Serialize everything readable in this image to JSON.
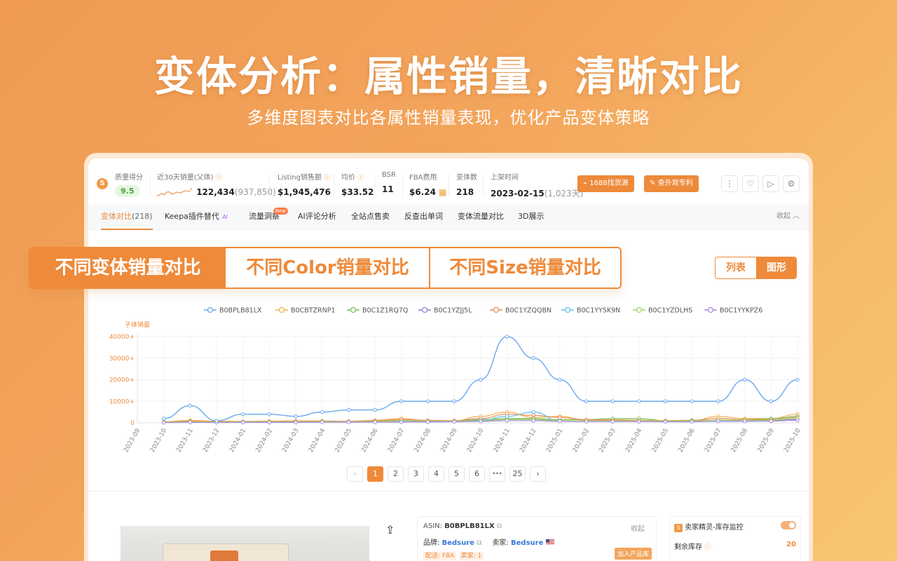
{
  "hero": {
    "title": "变体分析：属性销量，清晰对比",
    "subtitle": "多维度图表对比各属性销量表现，优化产品变体策略"
  },
  "metrics": {
    "logo": "S",
    "quality": {
      "label": "质量得分",
      "value": "9.5"
    },
    "sales30": {
      "label": "近30天销量(父体)",
      "value": "122,434",
      "sub": "(937,850)"
    },
    "listing": {
      "label": "Listing销售额",
      "value": "$1,945,476"
    },
    "avg_price": {
      "label": "均价",
      "value": "$33.52"
    },
    "bsr": {
      "label": "BSR",
      "value": "11"
    },
    "fba": {
      "label": "FBA费用",
      "value": "$6.24"
    },
    "variants": {
      "label": "变体数",
      "value": "218"
    },
    "launch": {
      "label": "上架时间",
      "value": "2023-02-15",
      "sub": "(1,023天)"
    },
    "btn_1688": "1688找货源",
    "btn_patent": "查外观专利"
  },
  "tabs": {
    "variant": "变体对比",
    "variant_count": "(218)",
    "keepa": "Keepa插件替代",
    "keepa_ai": "AI",
    "traffic": "流量洞察",
    "traffic_new": "New",
    "ai_review": "AI评论分析",
    "sitewide": "全站点售卖",
    "reverse": "反查出单词",
    "variant_traffic": "变体流量对比",
    "show3d": "3D展示",
    "collapse": "收起"
  },
  "segments": {
    "s1": "不同变体销量对比",
    "s2": "不同Color销量对比",
    "s3": "不同Size销量对比"
  },
  "view_toggle": {
    "list": "列表",
    "graph": "图形"
  },
  "chart_data": {
    "type": "line",
    "ylabel": "子体销量",
    "y_ticks": [
      "0",
      "10000+",
      "20000+",
      "30000+",
      "40000+"
    ],
    "ylim": [
      0,
      40000
    ],
    "x": [
      "2023-09",
      "2023-10",
      "2023-11",
      "2023-12",
      "2024-01",
      "2024-02",
      "2024-03",
      "2024-04",
      "2024-05",
      "2024-06",
      "2024-07",
      "2024-08",
      "2024-09",
      "2024-10",
      "2024-11",
      "2024-12",
      "2025-01",
      "2025-02",
      "2025-03",
      "2025-04",
      "2025-05",
      "2025-06",
      "2025-07",
      "2025-08",
      "2025-09",
      "2025-10"
    ],
    "legend_position": "top",
    "series": [
      {
        "name": "B0BPLB81LX",
        "color": "#6aa8ee",
        "values": [
          null,
          2000,
          8000,
          1000,
          4000,
          4000,
          3000,
          5000,
          6000,
          6000,
          10000,
          10000,
          10000,
          20000,
          40000,
          30000,
          20000,
          10000,
          10000,
          10000,
          10000,
          10000,
          10000,
          20000,
          10000,
          20000
        ]
      },
      {
        "name": "B0CBTZRNP1",
        "color": "#f3b04e",
        "values": [
          null,
          500,
          1200,
          800,
          700,
          800,
          900,
          900,
          700,
          1200,
          2000,
          1000,
          1000,
          3000,
          5000,
          2500,
          3000,
          1200,
          1500,
          1200,
          1000,
          1000,
          3000,
          2000,
          2000,
          4000
        ]
      },
      {
        "name": "B0C1Z1RQ7Q",
        "color": "#77c05a",
        "values": [
          null,
          300,
          600,
          400,
          500,
          500,
          500,
          800,
          600,
          800,
          1000,
          800,
          1000,
          1500,
          2000,
          2000,
          1500,
          1500,
          2000,
          2000,
          1000,
          1200,
          2000,
          1500,
          2000,
          3000
        ]
      },
      {
        "name": "B0C1YZJJ5L",
        "color": "#8c84e0",
        "values": [
          null,
          200,
          300,
          200,
          300,
          300,
          300,
          400,
          400,
          500,
          600,
          600,
          700,
          1000,
          1500,
          1500,
          1000,
          800,
          800,
          800,
          700,
          700,
          900,
          900,
          1000,
          1500
        ]
      },
      {
        "name": "B0C1YZQQBN",
        "color": "#ee8a5c",
        "values": [
          null,
          400,
          800,
          500,
          600,
          600,
          700,
          700,
          800,
          1000,
          1500,
          1200,
          1000,
          2000,
          4000,
          3500,
          2500,
          1500,
          1200,
          1200,
          1000,
          1000,
          2000,
          1500,
          1500,
          2500
        ]
      },
      {
        "name": "B0C1YYSK9N",
        "color": "#5fbfe8",
        "values": [
          null,
          200,
          400,
          300,
          400,
          400,
          400,
          500,
          500,
          600,
          800,
          700,
          800,
          1200,
          3000,
          5000,
          1000,
          800,
          800,
          800,
          700,
          700,
          900,
          900,
          1000,
          2000
        ]
      },
      {
        "name": "B0C1YZDLHS",
        "color": "#a3d65a",
        "values": [
          null,
          300,
          500,
          300,
          400,
          400,
          400,
          500,
          500,
          600,
          700,
          700,
          800,
          1000,
          1500,
          1500,
          1000,
          900,
          900,
          900,
          800,
          800,
          1200,
          1200,
          1200,
          2000
        ]
      },
      {
        "name": "B0C1YYKPZ6",
        "color": "#a98ae6",
        "values": [
          null,
          100,
          200,
          150,
          200,
          200,
          200,
          300,
          300,
          300,
          400,
          400,
          500,
          700,
          1000,
          1000,
          700,
          600,
          600,
          600,
          500,
          500,
          700,
          700,
          800,
          1200
        ]
      }
    ]
  },
  "pager": {
    "prev": "‹",
    "p1": "1",
    "p2": "2",
    "p3": "3",
    "p4": "4",
    "p5": "5",
    "p6": "6",
    "ellipsis": "•••",
    "last": "25",
    "next": "›"
  },
  "product": {
    "asin_label": "ASIN:",
    "asin": "B0BPLB81LX",
    "collapse": "收起",
    "brand_label": "品牌:",
    "brand": "Bedsure",
    "seller_label": "卖家:",
    "seller": "Bedsure",
    "ship_tag": "配送: FBA",
    "seller_tag": "卖家: 1",
    "add_lib": "加入产品库"
  },
  "stock": {
    "title": "卖家精灵-库存监控",
    "remain_label": "剩余库存",
    "remain_value": "20"
  }
}
